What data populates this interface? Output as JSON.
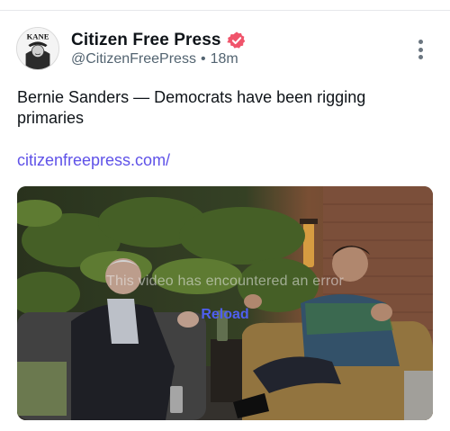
{
  "post": {
    "author": {
      "display_name": "Citizen Free Press",
      "handle": "@CitizenFreePress",
      "verified": true,
      "avatar_text": "KANE"
    },
    "separator": "•",
    "timestamp": "18m",
    "text": "Bernie Sanders — Democrats have been rigging primaries",
    "link": "citizenfreepress.com/",
    "media": {
      "type": "video",
      "error_message": "This video has encountered an error",
      "reload_label": "Reload"
    }
  },
  "colors": {
    "link": "#5f52e8",
    "verified_badge": "#f0546b",
    "reload": "#4f5ff0",
    "secondary_text": "#536471"
  },
  "icons": {
    "verified": "verified-badge-icon",
    "more": "more-vertical-icon"
  }
}
